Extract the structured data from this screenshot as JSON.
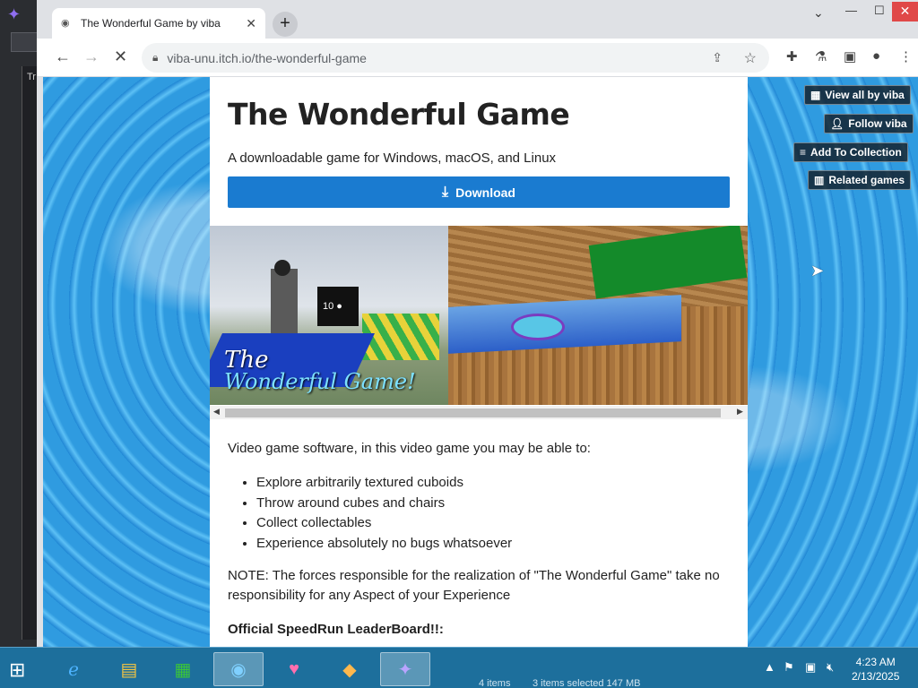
{
  "browser": {
    "tab_title": "The Wonderful Game by viba",
    "tab_close": "✕",
    "new_tab": "+",
    "url": "viba-unu.itch.io/the-wonderful-game",
    "window_buttons": {
      "minimize": "—",
      "maximize": "☐",
      "close": "✕",
      "tab_search": "⌄"
    }
  },
  "game_page": {
    "title": "The Wonderful Game",
    "subtitle": "A downloadable game for Windows, macOS, and Linux",
    "download_label": "Download",
    "screenshot_caption_line1": "The",
    "screenshot_caption_line2": "Wonderful Game!",
    "cube_label": "10",
    "intro": "Video game software, in this video game you may be able to:",
    "features": [
      "Explore arbitrarily textured cuboids",
      "Throw around cubes and chairs",
      "Collect collectables",
      "Experience absolutely no bugs whatsoever"
    ],
    "note": "NOTE: The forces responsible for the realization of \"The Wonderful Game\" take no responsibility for any Aspect of your Experience",
    "leaderboard_heading": "Official SpeedRun LeaderBoard!!:"
  },
  "side_actions": {
    "view_all": "View all by viba",
    "follow": "Follow viba",
    "add_collection": "Add To Collection",
    "related": "Related games"
  },
  "taskbar": {
    "time": "4:23 AM",
    "date": "2/13/2025",
    "explorer_items": "4 items",
    "explorer_selected": "3 items selected  147 MB"
  },
  "background_app": {
    "panel_label": "Tr"
  },
  "colors": {
    "download_button": "#1a7bd0",
    "taskbar": "#1d6f9c",
    "water": "#2a95dc"
  }
}
